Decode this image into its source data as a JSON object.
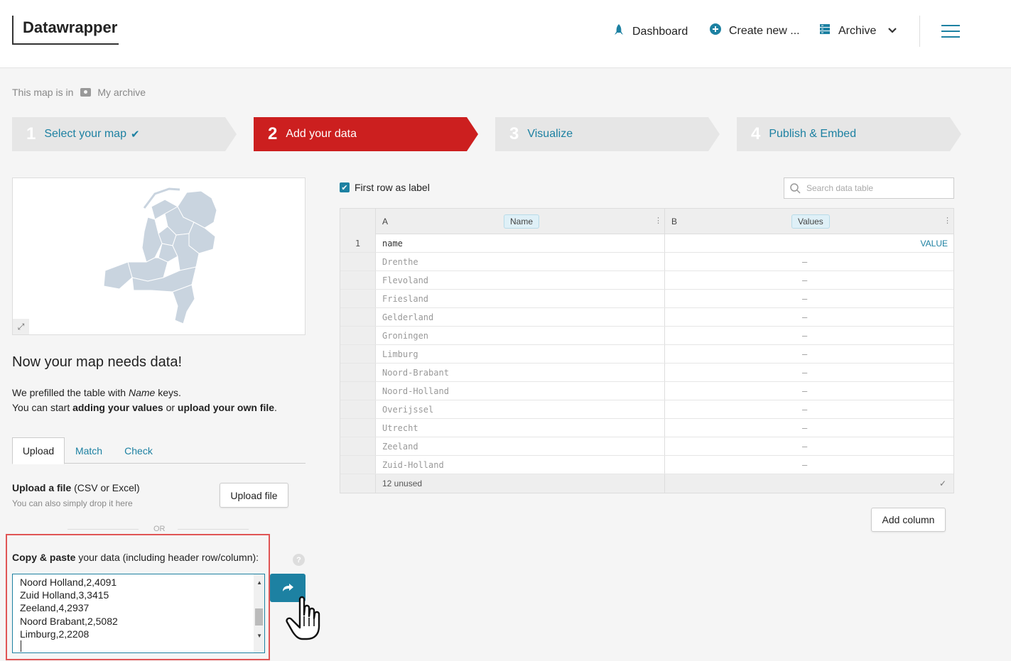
{
  "header": {
    "logo": "Datawrapper",
    "nav": {
      "dashboard": "Dashboard",
      "create_new": "Create new ...",
      "archive": "Archive"
    }
  },
  "breadcrumb": {
    "prefix": "This map is in",
    "folder": "My archive"
  },
  "steps": [
    {
      "num": "1",
      "label": "Select your map"
    },
    {
      "num": "2",
      "label": "Add your data"
    },
    {
      "num": "3",
      "label": "Visualize"
    },
    {
      "num": "4",
      "label": "Publish & Embed"
    }
  ],
  "left": {
    "title": "Now your map needs data!",
    "text1_a": "We prefilled the table with ",
    "text1_b": "Name",
    "text1_c": " keys.",
    "text2_a": "You can start ",
    "text2_b": "adding your values",
    "text2_c": " or ",
    "text2_d": "upload your own file",
    "text2_e": ".",
    "tabs": [
      "Upload",
      "Match",
      "Check"
    ],
    "upload_label_bold": "Upload a file",
    "upload_label_rest": " (CSV or Excel)",
    "upload_sub": "You can also simply drop it here",
    "upload_button": "Upload file",
    "or": "OR",
    "paste_label_bold": "Copy & paste",
    "paste_label_rest": " your data (including header row/column):",
    "help": "?",
    "paste_lines": [
      "Noord Holland,2,4091",
      "Zuid Holland,3,3415",
      "Zeeland,4,2937",
      "Noord Brabant,2,5082",
      "Limburg,2,2208"
    ]
  },
  "table": {
    "first_row_label": "First row as label",
    "search_placeholder": "Search data table",
    "col_a": "A",
    "col_b": "B",
    "badge_a": "Name",
    "badge_b": "Values",
    "header_row": {
      "idx": "1",
      "a": "name",
      "b": "VALUE"
    },
    "rows": [
      {
        "a": "Drenthe",
        "b": "–"
      },
      {
        "a": "Flevoland",
        "b": "–"
      },
      {
        "a": "Friesland",
        "b": "–"
      },
      {
        "a": "Gelderland",
        "b": "–"
      },
      {
        "a": "Groningen",
        "b": "–"
      },
      {
        "a": "Limburg",
        "b": "–"
      },
      {
        "a": "Noord-Brabant",
        "b": "–"
      },
      {
        "a": "Noord-Holland",
        "b": "–"
      },
      {
        "a": "Overijssel",
        "b": "–"
      },
      {
        "a": "Utrecht",
        "b": "–"
      },
      {
        "a": "Zeeland",
        "b": "–"
      },
      {
        "a": "Zuid-Holland",
        "b": "–"
      }
    ],
    "footer": "12 unused",
    "add_column": "Add column"
  },
  "colors": {
    "accent": "#1d81a2",
    "active_step": "#cc1f1f",
    "highlight": "#e05555"
  }
}
